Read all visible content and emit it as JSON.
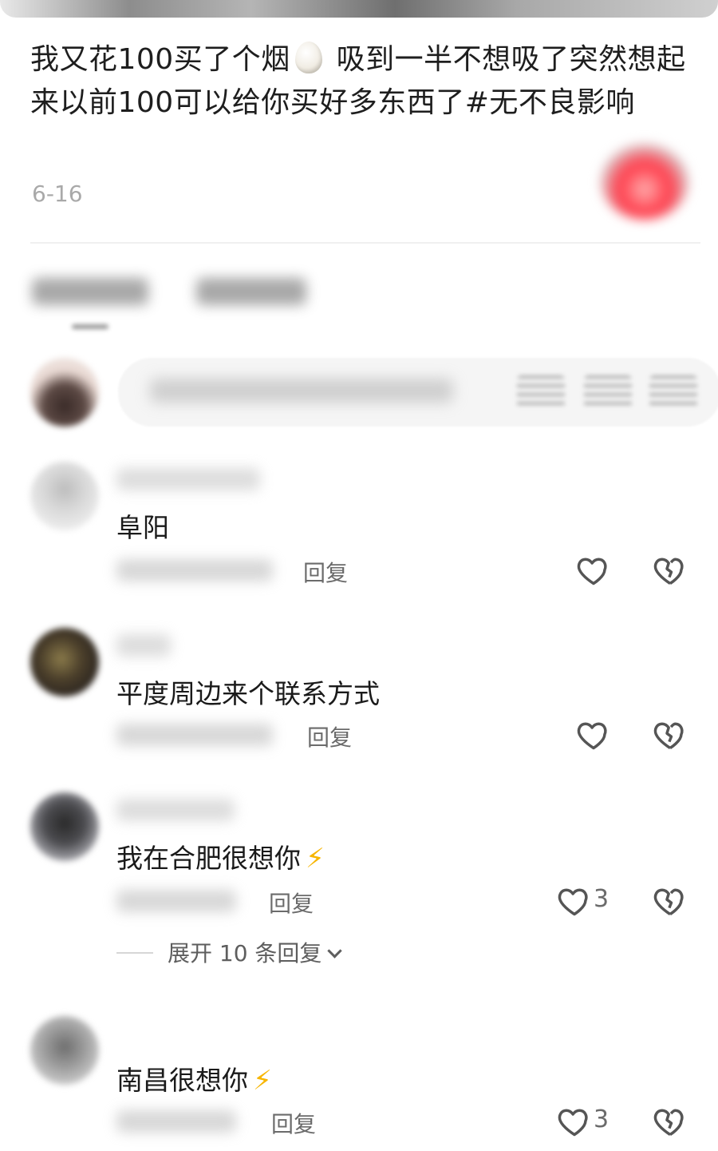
{
  "post": {
    "text_part1": "我又花100买了个烟",
    "egg_icon": "egg-emoji",
    "text_part2": " 吸到一半不想吸了突然想起来以前100可以给你买好多东西了#无不良影响",
    "date": "6-16"
  },
  "tabs": {
    "comments_label": "",
    "sort_label": ""
  },
  "composer": {
    "placeholder": ""
  },
  "comments": [
    {
      "username": "",
      "text": "阜阳",
      "bolt": "",
      "reply_label": "回复",
      "likes": ""
    },
    {
      "username": "",
      "text": "平度周边来个联系方式",
      "bolt": "",
      "reply_label": "回复",
      "likes": ""
    },
    {
      "username": "",
      "text": "我在合肥很想你",
      "bolt": "⚡",
      "reply_label": "回复",
      "likes": "3"
    },
    {
      "username": "",
      "text": "南昌很想你",
      "bolt": "⚡",
      "reply_label": "回复",
      "likes": "3"
    }
  ],
  "expand": {
    "label": "展开 10 条回复"
  },
  "colors": {
    "accent_bolt": "#f7b500",
    "muted": "#6b6b6b",
    "date": "#a9a9a9"
  }
}
